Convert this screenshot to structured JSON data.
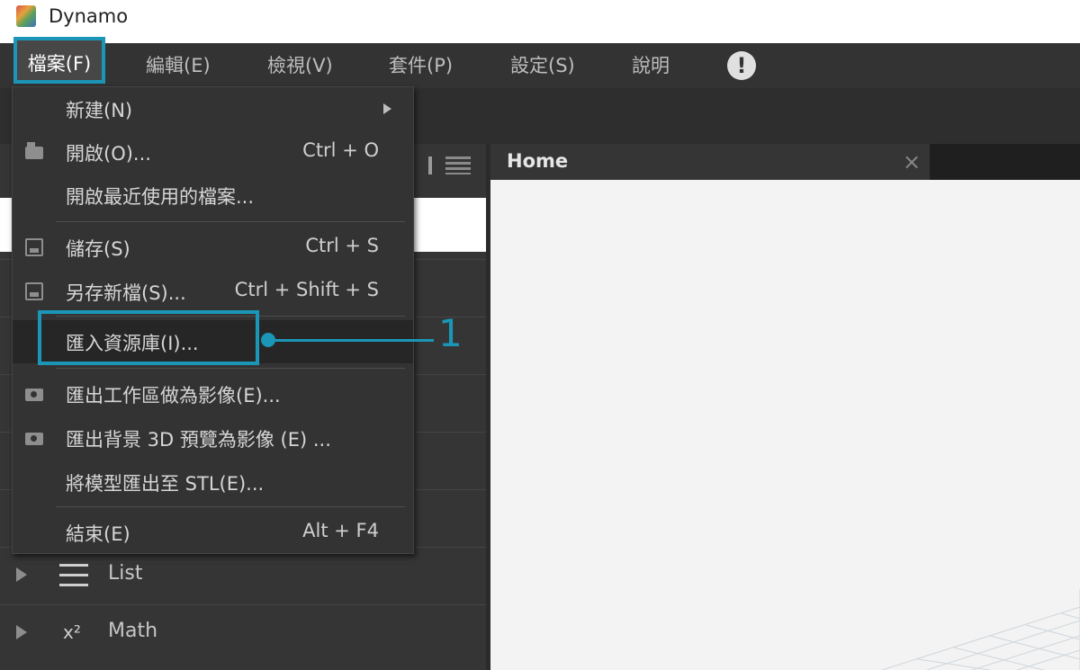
{
  "window": {
    "title": "Dynamo"
  },
  "menubar": {
    "items": [
      {
        "label": "檔案(F)"
      },
      {
        "label": "編輯(E)"
      },
      {
        "label": "檢視(V)"
      },
      {
        "label": "套件(P)"
      },
      {
        "label": "設定(S)"
      },
      {
        "label": "說明"
      }
    ],
    "alert_icon": "exclamation-icon"
  },
  "file_menu": {
    "new": {
      "label": "新建(N)"
    },
    "open": {
      "label": "開啟(O)...",
      "shortcut": "Ctrl + O"
    },
    "open_recent": {
      "label": "開啟最近使用的檔案..."
    },
    "save": {
      "label": "儲存(S)",
      "shortcut": "Ctrl + S"
    },
    "save_as": {
      "label": "另存新檔(S)...",
      "shortcut": "Ctrl + Shift + S"
    },
    "import_library": {
      "label": "匯入資源庫(I)..."
    },
    "export_workspace": {
      "label": "匯出工作區做為影像(E)..."
    },
    "export_3d": {
      "label": "匯出背景 3D 預覽為影像 (E) ..."
    },
    "export_stl": {
      "label": "將模型匯出至 STL(E)..."
    },
    "exit": {
      "label": "結束(E)",
      "shortcut": "Alt + F4"
    }
  },
  "library": {
    "rows": [
      {
        "label": "List"
      },
      {
        "label": "Math"
      }
    ],
    "math_glyph": "x²"
  },
  "workspace": {
    "tab_label": "Home",
    "tab_close": "×"
  },
  "annotation": {
    "number": "1"
  },
  "colors": {
    "accent": "#1b96b6",
    "menubar": "#333333"
  }
}
